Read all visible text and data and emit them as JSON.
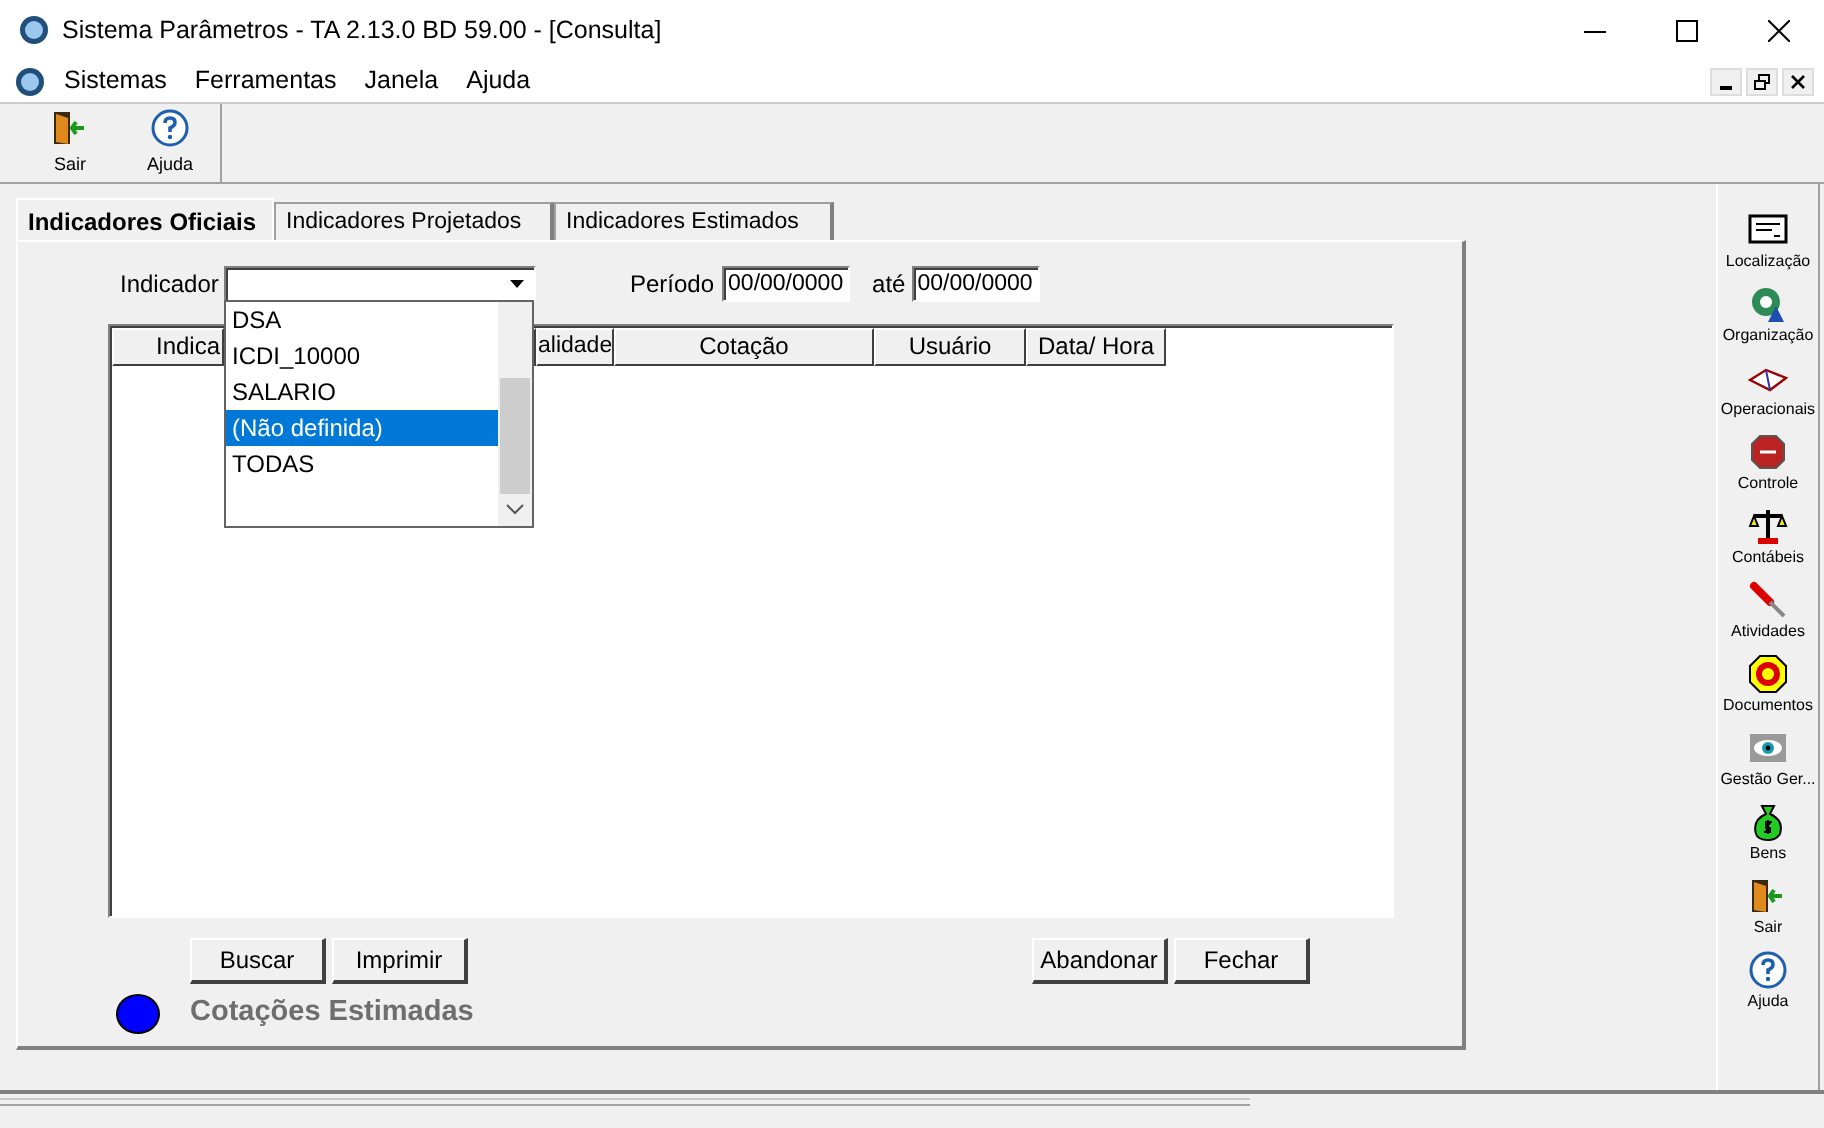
{
  "window": {
    "title": "Sistema Parâmetros -  TA 2.13.0 BD 59.00 - [Consulta]"
  },
  "menu": [
    "Sistemas",
    "Ferramentas",
    "Janela",
    "Ajuda"
  ],
  "toolbar": [
    {
      "label": "Sair"
    },
    {
      "label": "Ajuda"
    }
  ],
  "tabs": [
    {
      "label": "Indicadores Oficiais",
      "selected": true
    },
    {
      "label": "Indicadores Projetados",
      "selected": false
    },
    {
      "label": "Indicadores Estimados",
      "selected": false
    }
  ],
  "filter": {
    "indicador_label": "Indicador",
    "periodo_label": "Período",
    "periodo_from": "00/00/0000",
    "ate_label": "até",
    "periodo_to": "00/00/0000"
  },
  "dropdown": {
    "expanded": true,
    "items": [
      {
        "label": "DSA",
        "selected": false
      },
      {
        "label": "ICDI_10000",
        "selected": false
      },
      {
        "label": "SALARIO",
        "selected": false
      },
      {
        "label": "(Não definida)",
        "selected": true
      },
      {
        "label": "TODAS",
        "selected": false
      }
    ]
  },
  "table": {
    "columns": [
      "Indica",
      "alidade",
      "Cotação",
      "Usuário",
      "Data/ Hora"
    ]
  },
  "buttons_left": [
    "Buscar",
    "Imprimir"
  ],
  "buttons_right": [
    "Abandonar",
    "Fechar"
  ],
  "legend": {
    "color": "#0000ff",
    "label": "Cotações Estimadas"
  },
  "sidebar": {
    "items": [
      {
        "label": "Localização"
      },
      {
        "label": "Organização"
      },
      {
        "label": "Operacionais"
      },
      {
        "label": "Controle"
      },
      {
        "label": "Contábeis"
      },
      {
        "label": "Atividades"
      },
      {
        "label": "Documentos"
      },
      {
        "label": "Gestão Ger..."
      },
      {
        "label": "Bens"
      },
      {
        "label": "Sair"
      },
      {
        "label": "Ajuda"
      }
    ]
  }
}
